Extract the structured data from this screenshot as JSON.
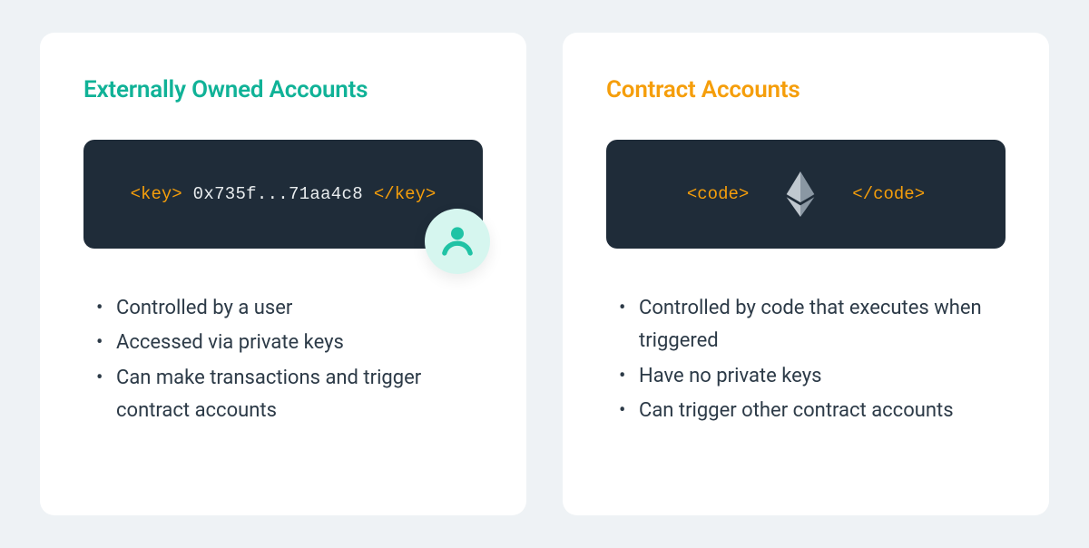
{
  "cards": [
    {
      "title": "Externally Owned Accounts",
      "codebox": {
        "open_tag": "<key>",
        "value": "0x735f...71aa4c8",
        "close_tag": "</key>"
      },
      "badge_icon": "user-icon",
      "features": [
        "Controlled by a user",
        "Accessed via  private keys",
        "Can make transactions and trigger contract accounts"
      ]
    },
    {
      "title": "Contract Accounts",
      "codebox": {
        "open_tag": "<code>",
        "center_icon": "ethereum-icon",
        "close_tag": "</code>"
      },
      "features": [
        "Controlled by code that executes when triggered",
        "Have no private keys",
        "Can trigger other contract accounts"
      ]
    }
  ]
}
